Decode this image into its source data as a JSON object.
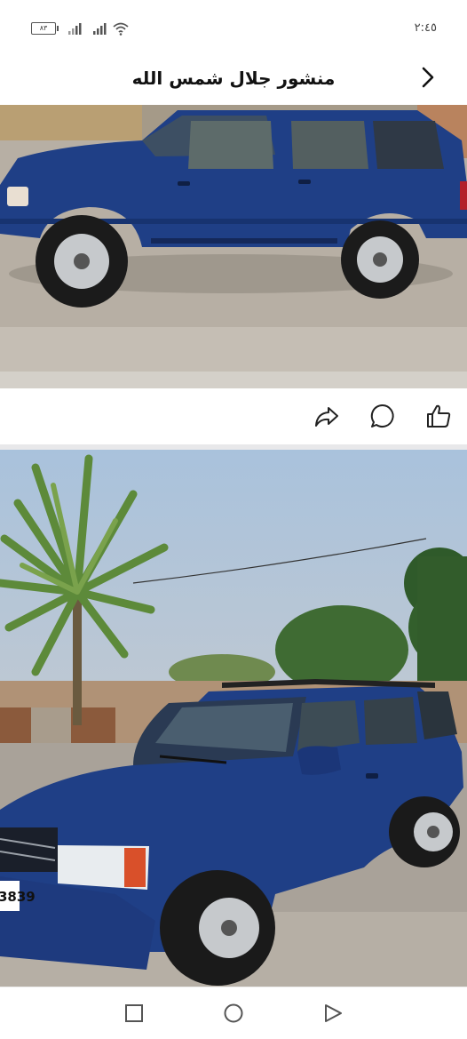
{
  "status_bar": {
    "time": "٢:٤٥",
    "battery_level": "٨٣",
    "icons": [
      "battery-icon",
      "signal-icon",
      "signal-icon",
      "wifi-icon"
    ]
  },
  "header": {
    "title": "منشور جلال شمس الله",
    "back_icon": "chevron-right-icon"
  },
  "post": {
    "photos": [
      {
        "subject": "blue SUV side view on gravel",
        "plate_text": ""
      },
      {
        "subject": "blue SUV front three-quarter view with palm tree",
        "plate_text": "3839"
      }
    ],
    "actions": [
      "share-icon",
      "comment-icon",
      "like-icon"
    ]
  },
  "nav_bar": {
    "buttons": [
      "recent-apps-icon",
      "home-icon",
      "back-icon"
    ]
  },
  "colors": {
    "car_blue": "#1f3f86",
    "sky": "#b9c9d9",
    "gravel": "#b4aca1",
    "divider": "#e8e8ea"
  }
}
